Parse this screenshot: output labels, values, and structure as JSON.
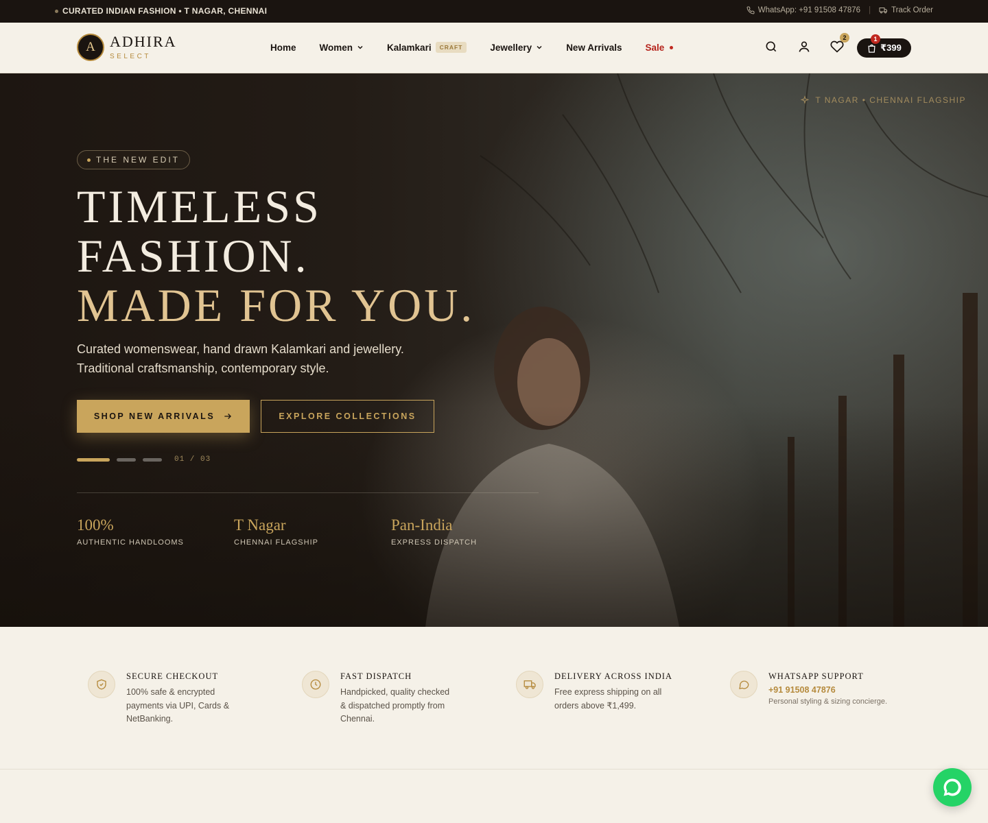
{
  "topbar": {
    "promo": "CURATED INDIAN FASHION • T NAGAR, CHENNAI",
    "whatsapp": "WhatsApp: +91 91508 47876",
    "track_order": "Track Order"
  },
  "brand": {
    "initial": "A",
    "name": "ADHIRA",
    "tagline": "SELECT"
  },
  "nav": {
    "items": [
      {
        "label": "Home"
      },
      {
        "label": "Women"
      },
      {
        "label": "Kalamkari",
        "tag": "CRAFT"
      },
      {
        "label": "Jewellery"
      },
      {
        "label": "New Arrivals"
      },
      {
        "label": "Sale"
      }
    ],
    "wishlist_count": "2",
    "cart_count": "1",
    "cart_total": "₹399"
  },
  "hero": {
    "location": "T NAGAR • CHENNAI FLAGSHIP",
    "pill": "THE NEW EDIT",
    "headline_1": "TIMELESS",
    "headline_2": "FASHION.",
    "headline_3": "MADE FOR YOU.",
    "sub_1": "Curated womenswear, hand drawn Kalamkari and jewellery.",
    "sub_2": "Traditional craftsmanship, contemporary style.",
    "cta_primary": "SHOP NEW ARRIVALS",
    "cta_secondary": "EXPLORE COLLECTIONS",
    "slide_counter": "01 / 03",
    "stats": [
      {
        "value": "100%",
        "label": "AUTHENTIC HANDLOOMS"
      },
      {
        "value": "T Nagar",
        "label": "CHENNAI FLAGSHIP"
      },
      {
        "value": "Pan-India",
        "label": "EXPRESS DISPATCH"
      }
    ]
  },
  "features": [
    {
      "icon": "shield-check-icon",
      "title": "SECURE CHECKOUT",
      "desc": "100% safe & encrypted payments via UPI, Cards & NetBanking."
    },
    {
      "icon": "clock-icon",
      "title": "FAST DISPATCH",
      "desc": "Handpicked, quality checked & dispatched promptly from Chennai."
    },
    {
      "icon": "truck-icon",
      "title": "DELIVERY ACROSS INDIA",
      "desc": "Free express shipping on all orders above ₹1,499."
    },
    {
      "icon": "chat-bubble-icon",
      "title": "WHATSAPP SUPPORT",
      "phone": "+91 91508 47876",
      "desc": "Personal styling & sizing concierge."
    }
  ],
  "colors": {
    "dark": "#1a1410",
    "gold": "#c9a55c",
    "cream": "#f5f1e8",
    "sale": "#b5231b",
    "whatsapp": "#25d366"
  }
}
